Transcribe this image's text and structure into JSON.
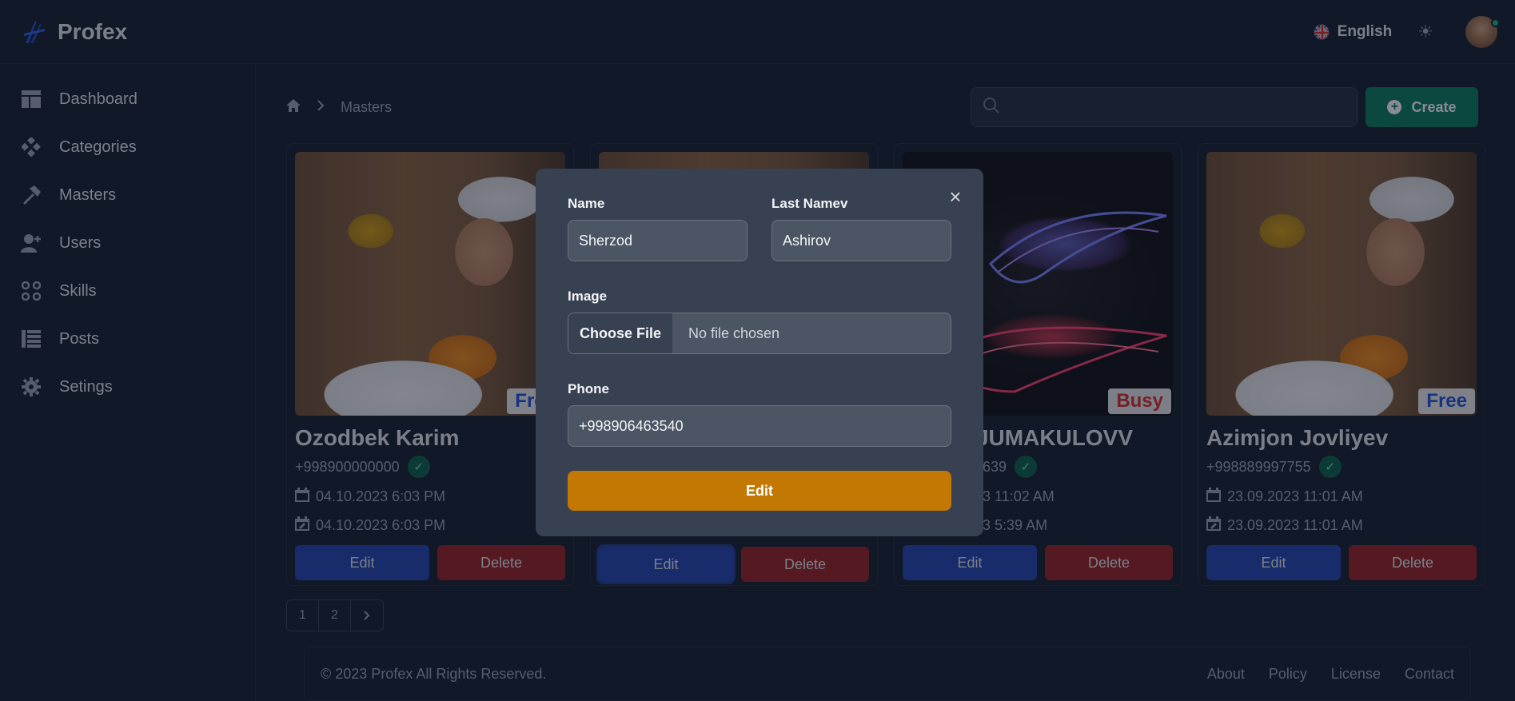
{
  "app": {
    "brand": "Profex"
  },
  "header": {
    "language": "English",
    "language_flag": "uk-flag-icon",
    "theme_icon": "sun-icon"
  },
  "sidebar": {
    "items": [
      {
        "label": "Dashboard",
        "icon": "dashboard-icon"
      },
      {
        "label": "Categories",
        "icon": "categories-icon"
      },
      {
        "label": "Masters",
        "icon": "hammer-icon"
      },
      {
        "label": "Users",
        "icon": "user-add-icon"
      },
      {
        "label": "Skills",
        "icon": "skills-icon"
      },
      {
        "label": "Posts",
        "icon": "list-icon"
      },
      {
        "label": "Setings",
        "icon": "gear-icon"
      }
    ]
  },
  "breadcrumb": {
    "current": "Masters"
  },
  "search": {
    "placeholder": "",
    "value": ""
  },
  "toolbar": {
    "create_label": "Create"
  },
  "cards": [
    {
      "name": "Ozodbek Karim",
      "phone": "+998900000000",
      "created": "04.10.2023 6:03 PM",
      "updated": "04.10.2023 6:03 PM",
      "status": "Free",
      "edit": "Edit",
      "delete": "Delete"
    },
    {
      "name": "",
      "phone": "",
      "created": "",
      "updated": "",
      "status": "",
      "edit": "Edit",
      "delete": "Delete"
    },
    {
      "name": "JUMAKULOVV",
      "phone": "9639",
      "created": "23 11:02 AM",
      "updated": "23 5:39 AM",
      "status": "Busy",
      "edit": "Edit",
      "delete": "Delete"
    },
    {
      "name": "Azimjon Jovliyev",
      "phone": "+998889997755",
      "created": "23.09.2023 11:01 AM",
      "updated": "23.09.2023 11:01 AM",
      "status": "Free",
      "edit": "Edit",
      "delete": "Delete"
    }
  ],
  "pagination": {
    "pages": [
      "1",
      "2"
    ],
    "next": "›"
  },
  "footer": {
    "copyright": "© 2023 Profex All Rights Reserved.",
    "links": [
      "About",
      "Policy",
      "License",
      "Contact"
    ]
  },
  "modal": {
    "name_label": "Name",
    "name_value": "Sherzod",
    "last_name_label": "Last Namev",
    "last_name_value": "Ashirov",
    "image_label": "Image",
    "choose_file": "Choose File",
    "no_file": "No file chosen",
    "phone_label": "Phone",
    "phone_value": "+998906463540",
    "submit_label": "Edit",
    "close": "×"
  },
  "colors": {
    "background": "#111827",
    "create": "#047857",
    "edit": "#1e40af",
    "delete": "#991b1b",
    "submit": "#c27803",
    "modal": "#374151"
  }
}
